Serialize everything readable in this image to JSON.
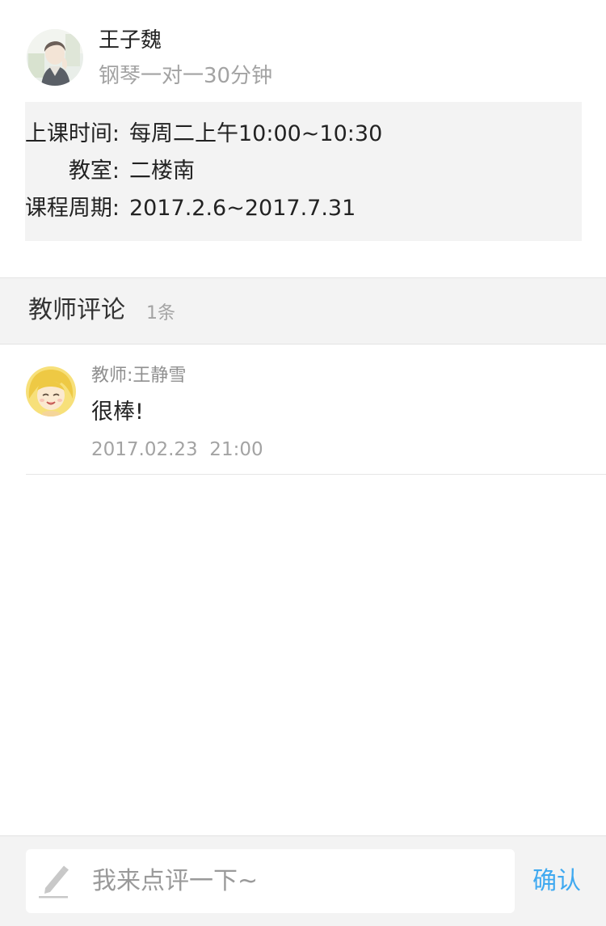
{
  "student": {
    "avatar_icon": "student-avatar-photo",
    "name": "王子魏",
    "course": "钢琴一对一30分钟"
  },
  "info": {
    "rows": [
      {
        "label": "上课时间:",
        "value": "每周二上午10:00~10:30"
      },
      {
        "label": "教室:",
        "value": "二楼南"
      },
      {
        "label": "课程周期:",
        "value": "2017.2.6~2017.7.31"
      }
    ]
  },
  "comments_section": {
    "title": "教师评论",
    "count": "1条",
    "items": [
      {
        "avatar_icon": "teacher-avatar-cartoon",
        "author": "教师:王静雪",
        "text": "很棒!",
        "time": "2017.02.23  21:00"
      }
    ]
  },
  "composer": {
    "icon": "pencil-icon",
    "placeholder": "我来点评一下~",
    "value": "",
    "confirm_label": "确认"
  },
  "colors": {
    "accent": "#3fa9f0",
    "muted_text": "#a3a3a3",
    "panel_bg": "#f3f3f3"
  }
}
